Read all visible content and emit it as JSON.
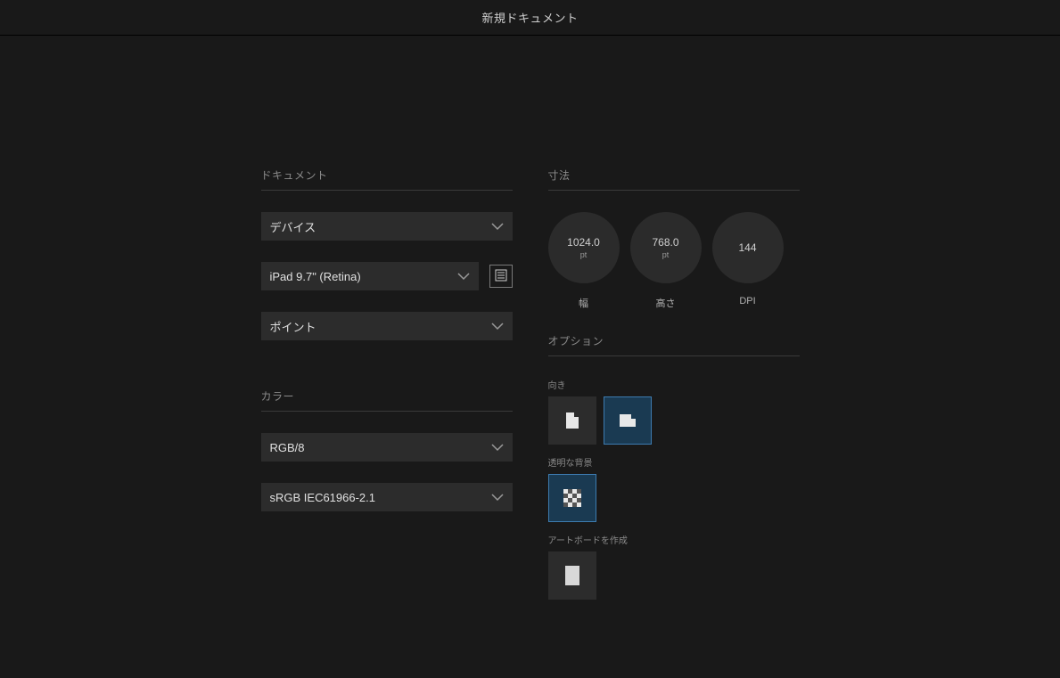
{
  "title": "新規ドキュメント",
  "left": {
    "document_section": "ドキュメント",
    "type_label": "デバイス",
    "preset_label": "iPad 9.7\" (Retina)",
    "units_label": "ポイント",
    "color_section": "カラー",
    "color_format": "RGB/8",
    "color_profile": "sRGB IEC61966-2.1"
  },
  "right": {
    "dimensions_section": "寸法",
    "width_value": "1024.0",
    "width_unit": "pt",
    "width_label": "幅",
    "height_value": "768.0",
    "height_unit": "pt",
    "height_label": "高さ",
    "dpi_value": "144",
    "dpi_label": "DPI",
    "options_section": "オプション",
    "orientation_label": "向き",
    "transparent_bg_label": "透明な背景",
    "create_artboard_label": "アートボードを作成"
  }
}
